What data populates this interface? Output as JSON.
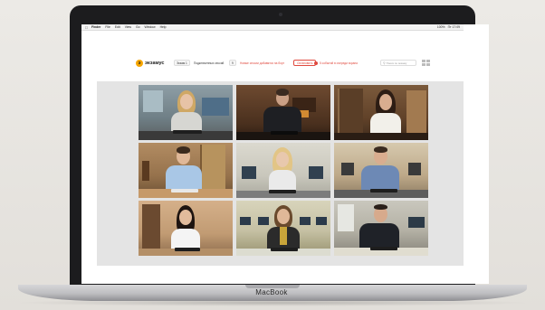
{
  "device": {
    "label": "MacBook"
  },
  "menubar": {
    "apple_icon": "apple-icon",
    "items": [
      "Finder",
      "File",
      "Edit",
      "View",
      "Go",
      "Window",
      "Help"
    ],
    "status": [
      "100%",
      "Пт 17:09"
    ]
  },
  "app": {
    "logo_text": "экзамус",
    "filter_label": "Экзам 1",
    "connected_label": "Подключенных сессий",
    "connected_count": "9",
    "notice": "Новые сессии добавятся на борт",
    "stop_button": "Остановить",
    "warning": "5 событий в очереди экрана",
    "search_placeholder": "Поиск по экзаму",
    "view_toggle_icon": "grid-view-icon"
  },
  "grid": {
    "tiles": [
      {
        "id": "1",
        "bg": "#7a8a92"
      },
      {
        "id": "2",
        "bg": "#5a3c28"
      },
      {
        "id": "3",
        "bg": "#6a4e34"
      },
      {
        "id": "4",
        "bg": "#9c7a55"
      },
      {
        "id": "5",
        "bg": "#c7c4b8"
      },
      {
        "id": "6",
        "bg": "#bfae8e"
      },
      {
        "id": "7",
        "bg": "#c9a27a"
      },
      {
        "id": "8",
        "bg": "#b8b39a"
      },
      {
        "id": "9",
        "bg": "#b9b6ac"
      }
    ]
  }
}
